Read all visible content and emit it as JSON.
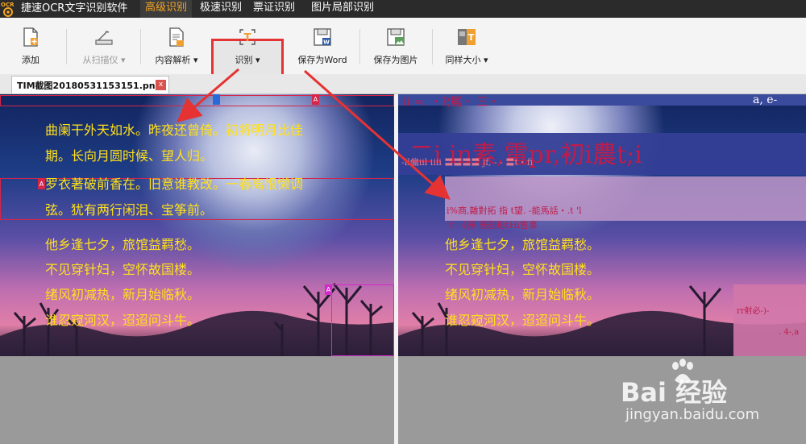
{
  "titlebar": {
    "app_title": "捷速OCR文字识别软件",
    "logo_text": "OCR",
    "tabs": [
      {
        "label": "高级识别",
        "active": true
      },
      {
        "label": "极速识别",
        "active": false
      },
      {
        "label": "票证识别",
        "active": false
      },
      {
        "label": "图片局部识别",
        "active": false
      }
    ]
  },
  "toolbar": {
    "add": "添加",
    "scanner": "从扫描仪",
    "content_parse": "内容解析",
    "recognize": "识别",
    "save_word": "保存为Word",
    "save_image": "保存为图片",
    "same_size": "同样大小"
  },
  "doc_tab": {
    "filename": "TIM截图20180531153151.png",
    "close": "x"
  },
  "left_pane": {
    "poem_lines": [
      "曲阑干外天如水。昨夜还曾倚。初将明月比佳",
      "期。长向月圆时候、望人归。",
      "罗衣著破前香在。旧意谁教改。一春离恨懒调",
      "弦。犹有两行闲泪、宝筝前。",
      "他乡逢七夕，旅馆益羁愁。",
      "不见穿针妇，空怀故国楼。",
      "绪风初减热，新月始临秋。",
      "谁忍窥河汉，迢迢问斗牛。"
    ],
    "markers": [
      "A",
      "A",
      "A"
    ]
  },
  "right_pane": {
    "ocr_lines": [
      "ii =.  ・P,属・  三・",
      "a, e-",
      "二i in素,電pr,初i農t;i",
      "-ll偏iil iiii   〓〓〓〓 jf, -  -  〓t・fi",
      "i%商,雜對拓  指  t望.    -能馬話・.t  'l",
      "t . 4豫   表部形tHi售事",
      "rr射必-)-",
      ". 4-,a"
    ],
    "poem_lines": [
      "他乡逢七夕，旅馆益羁愁。",
      "不见穿针妇，空怀故国楼。",
      "绪风初减热，新月始临秋。",
      "谁忍窥河汉，迢迢问斗牛。"
    ]
  },
  "watermark": {
    "brand": "Bai 经验",
    "url": "jingyan.baidu.com"
  },
  "colors": {
    "highlight": "#e53333",
    "poem": "#ffe11a",
    "active_tab": "#f5a623"
  }
}
